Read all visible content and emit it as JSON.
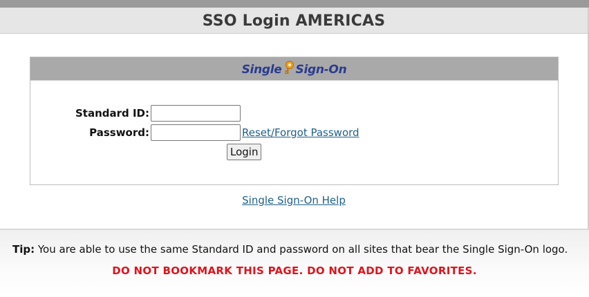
{
  "header": {
    "title": "SSO Login AMERICAS"
  },
  "logo": {
    "text_left": "Single",
    "text_right": "Sign-On",
    "icon": "key-icon",
    "colors": {
      "text": "#2a3b8f",
      "key": "#f0a21a"
    }
  },
  "form": {
    "standard_id_label": "Standard ID:",
    "standard_id_value": "",
    "password_label": "Password:",
    "password_value": "",
    "reset_link": "Reset/Forgot Password",
    "login_button": "Login"
  },
  "help_link": "Single Sign-On Help",
  "footer": {
    "tip_label": "Tip:",
    "tip_text": " You are able to use the same Standard ID and password on all sites that bear the Single Sign-On logo.",
    "warning": "DO NOT BOOKMARK THIS PAGE. DO NOT ADD TO FAVORITES."
  },
  "colors": {
    "header_bg": "#e6e6e6",
    "panel_header_bg": "#a9a9a9",
    "link": "#1d5f8a",
    "warning": "#e0121b"
  }
}
